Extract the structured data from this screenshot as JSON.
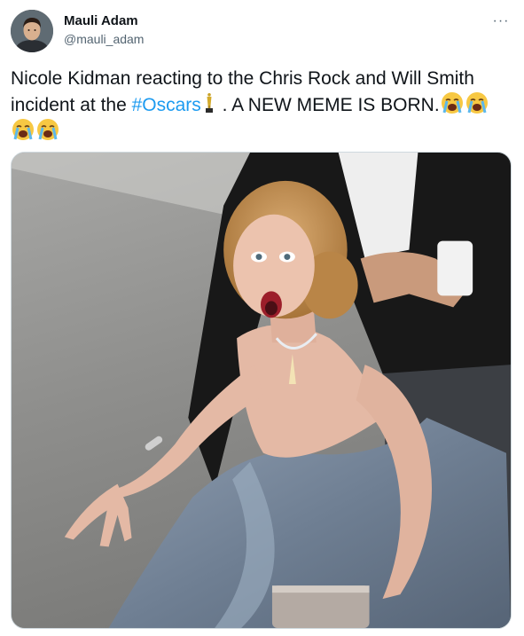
{
  "author": {
    "display_name": "Mauli Adam",
    "handle": "@mauli_adam"
  },
  "tweet": {
    "text_part1": "Nicole Kidman reacting to the Chris Rock and Will Smith incident at the ",
    "hashtag": "#Oscars",
    "text_part2": " . A NEW MEME IS BORN.",
    "emojis": [
      "oscar-trophy-emoji",
      "loudly-crying-face-emoji",
      "loudly-crying-face-emoji",
      "loudly-crying-face-emoji",
      "loudly-crying-face-emoji"
    ]
  },
  "menu": {
    "more_label": "···"
  },
  "colors": {
    "text": "#0f1419",
    "secondary": "#536471",
    "link": "#1d9bf0"
  }
}
